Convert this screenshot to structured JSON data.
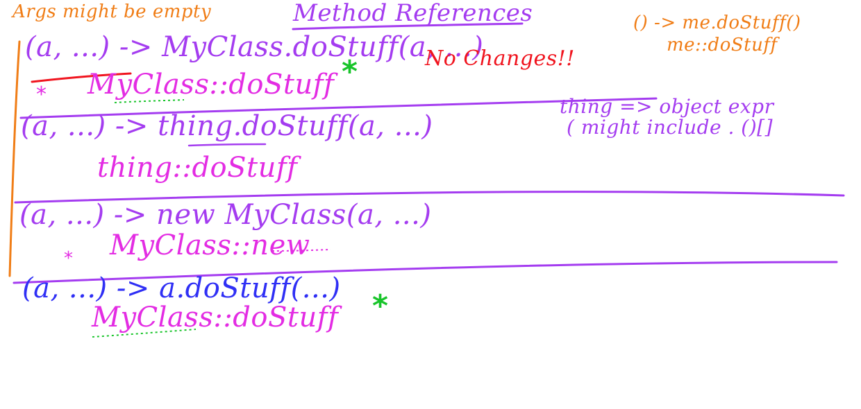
{
  "colors": {
    "orange": "#f07d16",
    "purple": "#a43cf0",
    "blue": "#2f2ff5",
    "magenta": "#e32ce3",
    "red": "#f0141e",
    "green": "#18c42a"
  },
  "top_note": {
    "text": "Args might be empty"
  },
  "title": {
    "text": "Method References"
  },
  "corner_note": {
    "line1": "() -> me.doStuff()",
    "line2": "me::doStuff"
  },
  "rows": [
    {
      "lambda": "(a, ...) -> MyClass.doStuff(a, ...)",
      "ref": "MyClass::doStuff",
      "star": "*",
      "mark": "*",
      "note": "No Changes!!"
    },
    {
      "lambda": "(a, ...) -> thing.doStuff(a, ...)",
      "ref": "thing::doStuff",
      "side_note_1": "thing => object expr",
      "side_note_2": "( might include . ()[]"
    },
    {
      "lambda": "(a, ...) -> new MyClass(a, ...)",
      "ref": "MyClass::new",
      "mark": "*"
    },
    {
      "lambda": "(a, ...) -> a.doStuff(...)",
      "ref": "MyClass::doStuff",
      "star": "*"
    }
  ]
}
